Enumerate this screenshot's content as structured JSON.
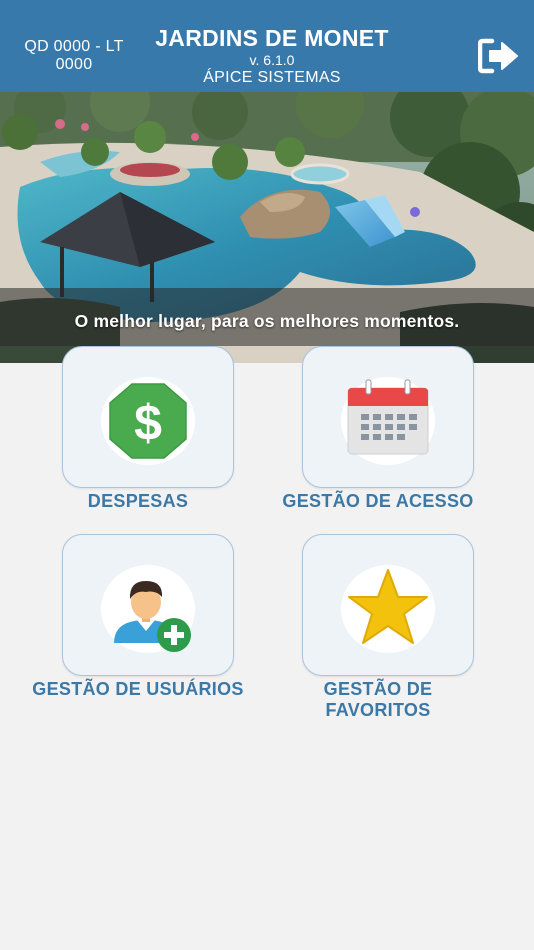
{
  "header": {
    "unit": "QD 0000 - LT 0000",
    "title": "JARDINS DE MONET",
    "version": "v. 6.1.0",
    "company": "ÁPICE SISTEMAS",
    "logout_icon": "logout-icon"
  },
  "banner": {
    "tagline": "O melhor lugar, para os melhores momentos."
  },
  "menu": [
    {
      "label": "DESPESAS",
      "icon": "dollar-icon"
    },
    {
      "label": "GESTÃO DE ACESSO",
      "icon": "calendar-icon"
    },
    {
      "label": "GESTÃO DE USUÁRIOS",
      "icon": "add-user-icon"
    },
    {
      "label": "GESTÃO DE FAVORITOS",
      "icon": "star-icon"
    }
  ],
  "colors": {
    "header": "#3879ac",
    "label": "#3c78a6",
    "card_bg": "#eef3f8",
    "card_border": "#aac4dc"
  }
}
